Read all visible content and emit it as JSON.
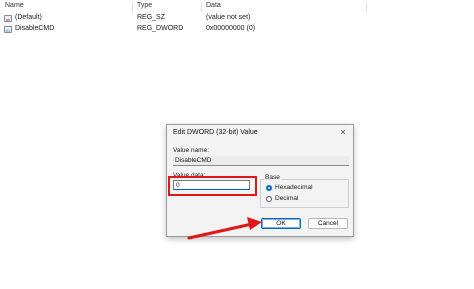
{
  "list": {
    "columns": {
      "name": "Name",
      "type": "Type",
      "data": "Data"
    },
    "rows": [
      {
        "icon": "string-value-icon",
        "icon_text": "ab",
        "name": "(Default)",
        "type": "REG_SZ",
        "data": "(value not set)"
      },
      {
        "icon": "dword-value-icon",
        "icon_text": "01",
        "name": "DisableCMD",
        "type": "REG_DWORD",
        "data": "0x00000000 (0)"
      }
    ]
  },
  "dialog": {
    "title": "Edit DWORD (32-bit) Value",
    "close_glyph": "×",
    "value_name_label": "Value name:",
    "value_name": "DisableCMD",
    "value_data_label": "Value data:",
    "value_data": "0",
    "base_label": "Base",
    "base_options": [
      {
        "label": "Hexadecimal",
        "selected": true
      },
      {
        "label": "Decimal",
        "selected": false
      }
    ],
    "ok_label": "OK",
    "cancel_label": "Cancel"
  },
  "colors": {
    "highlight": "#e01818",
    "accent": "#0067c0",
    "arrow": "#e01818"
  }
}
